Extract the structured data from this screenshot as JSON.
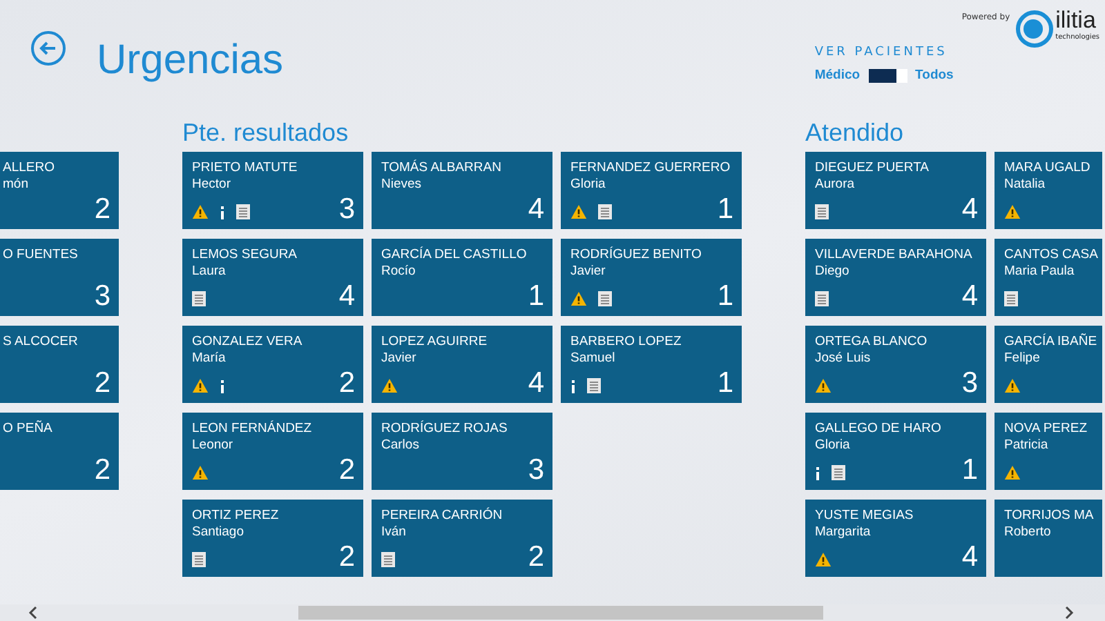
{
  "header": {
    "title": "Urgencias",
    "filter": {
      "label": "VER PACIENTES",
      "left_option": "Médico",
      "right_option": "Todos",
      "on": true
    },
    "brand": {
      "powered_by": "Powered by",
      "name": "ilitia",
      "tagline": "technologies"
    }
  },
  "groups": [
    {
      "columns": [
        {
          "kind": "cut_left",
          "tiles": [
            {
              "name": "ALLERO",
              "first_name": "món",
              "count": "2",
              "warning": false,
              "info": false,
              "document": false
            },
            {
              "name": "O FUENTES",
              "count": "3",
              "warning": false,
              "info": false,
              "document": false
            },
            {
              "name": "S ALCOCER",
              "count": "2",
              "warning": false,
              "info": false,
              "document": false
            },
            {
              "name": "O PEÑA",
              "count": "2",
              "warning": false,
              "info": false,
              "document": false
            }
          ]
        }
      ]
    },
    {
      "heading": "Pte. resultados",
      "columns": [
        {
          "kind": "full",
          "tiles": [
            {
              "name": "PRIETO MATUTE",
              "first_name": "Hector",
              "count": "3",
              "warning": true,
              "info": true,
              "document": true
            },
            {
              "name": "LEMOS SEGURA",
              "first_name": "Laura",
              "count": "4",
              "warning": false,
              "info": false,
              "document": true
            },
            {
              "name": "GONZALEZ VERA",
              "first_name": "María",
              "count": "2",
              "warning": true,
              "info": true,
              "document": false
            },
            {
              "name": "LEON FERNÁNDEZ",
              "first_name": "Leonor",
              "count": "2",
              "warning": true,
              "info": false,
              "document": false
            },
            {
              "name": "ORTIZ PEREZ",
              "first_name": "Santiago",
              "count": "2",
              "warning": false,
              "info": false,
              "document": true
            }
          ]
        },
        {
          "kind": "full",
          "tiles": [
            {
              "name": "TOMÁS ALBARRAN",
              "first_name": "Nieves",
              "count": "4",
              "warning": false,
              "info": false,
              "document": false
            },
            {
              "name": "GARCÍA DEL CASTILLO",
              "first_name": "Rocío",
              "count": "1",
              "warning": false,
              "info": false,
              "document": false
            },
            {
              "name": "LOPEZ AGUIRRE",
              "first_name": "Javier",
              "count": "4",
              "warning": true,
              "info": false,
              "document": false
            },
            {
              "name": "RODRÍGUEZ ROJAS",
              "first_name": "Carlos",
              "count": "3",
              "warning": false,
              "info": false,
              "document": false
            },
            {
              "name": "PEREIRA CARRIÓN",
              "first_name": "Iván",
              "count": "2",
              "warning": false,
              "info": false,
              "document": true
            }
          ]
        },
        {
          "kind": "full",
          "tiles": [
            {
              "name": "FERNANDEZ GUERRERO",
              "first_name": "Gloria",
              "count": "1",
              "warning": true,
              "info": false,
              "document": true
            },
            {
              "name": "RODRÍGUEZ BENITO",
              "first_name": "Javier",
              "count": "1",
              "warning": true,
              "info": false,
              "document": true
            },
            {
              "name": "BARBERO LOPEZ",
              "first_name": "Samuel",
              "count": "1",
              "warning": false,
              "info": true,
              "document": true
            }
          ]
        }
      ]
    },
    {
      "heading": "Atendido",
      "columns": [
        {
          "kind": "full",
          "tiles": [
            {
              "name": "DIEGUEZ PUERTA",
              "first_name": "Aurora",
              "count": "4",
              "warning": false,
              "info": false,
              "document": true
            },
            {
              "name": "VILLAVERDE BARAHONA",
              "first_name": "Diego",
              "count": "4",
              "warning": false,
              "info": false,
              "document": true
            },
            {
              "name": "ORTEGA BLANCO",
              "first_name": "José Luis",
              "count": "3",
              "warning": true,
              "info": false,
              "document": false
            },
            {
              "name": "GALLEGO DE HARO",
              "first_name": "Gloria",
              "count": "1",
              "warning": false,
              "info": true,
              "document": true
            },
            {
              "name": "YUSTE MEGIAS",
              "first_name": "Margarita",
              "count": "4",
              "warning": true,
              "info": false,
              "document": false
            }
          ]
        },
        {
          "kind": "cut_right",
          "tiles": [
            {
              "name": "MARA UGALD",
              "first_name": "Natalia",
              "warning": true,
              "info": false,
              "document": false
            },
            {
              "name": "CANTOS CASA",
              "first_name": "Maria Paula",
              "warning": false,
              "info": false,
              "document": true
            },
            {
              "name": "GARCÍA IBAÑE",
              "first_name": "Felipe",
              "warning": true,
              "info": false,
              "document": false
            },
            {
              "name": "NOVA PEREZ",
              "first_name": "Patricia",
              "warning": true,
              "info": false,
              "document": false
            },
            {
              "name": "TORRIJOS MA",
              "first_name": "Roberto",
              "warning": false,
              "info": false,
              "document": false
            }
          ]
        }
      ]
    }
  ]
}
